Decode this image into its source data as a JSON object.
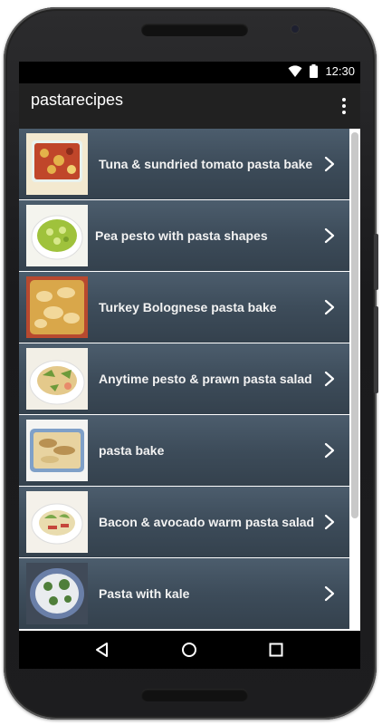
{
  "status_bar": {
    "time": "12:30",
    "icons": [
      "wifi-icon",
      "battery-icon"
    ]
  },
  "app_bar": {
    "title": "pastarecipes",
    "menu_icon": "overflow-menu-icon"
  },
  "recipes": [
    {
      "label": "Tuna & sundried tomato pasta bake",
      "thumb_colors": [
        "#c0462a",
        "#e4b24a",
        "#f3e9d0"
      ],
      "thumb_style": "bake-red"
    },
    {
      "label": "Pea pesto with pasta shapes",
      "thumb_colors": [
        "#9fc23c",
        "#d7e88a",
        "#f4f4ee"
      ],
      "thumb_style": "bowl-green"
    },
    {
      "label": "Turkey Bolognese pasta bake",
      "thumb_colors": [
        "#d9a74a",
        "#f2d89a",
        "#b8492f"
      ],
      "thumb_style": "bake-gold"
    },
    {
      "label": "Anytime pesto & prawn pasta salad",
      "thumb_colors": [
        "#6d9a3a",
        "#e4c98b",
        "#f2efe6"
      ],
      "thumb_style": "plate-salad"
    },
    {
      "label": "pasta bake",
      "thumb_colors": [
        "#e8d3a0",
        "#b99152",
        "#7fa0c8"
      ],
      "thumb_style": "dish-blue"
    },
    {
      "label": "Bacon & avocado warm pasta salad",
      "thumb_colors": [
        "#7aa84a",
        "#c5463a",
        "#f4f1ea"
      ],
      "thumb_style": "plate-bacon"
    },
    {
      "label": "Pasta with kale",
      "thumb_colors": [
        "#4f7f3a",
        "#e9ecef",
        "#6a7fa8"
      ],
      "thumb_style": "plate-kale"
    }
  ],
  "nav_bar": {
    "icons": [
      "back-icon",
      "home-icon",
      "recents-icon"
    ]
  },
  "colors": {
    "row_top": "#4c5d6d",
    "row_bottom": "#34414d",
    "app_bar": "#212121",
    "label": "#f2f2f2"
  }
}
